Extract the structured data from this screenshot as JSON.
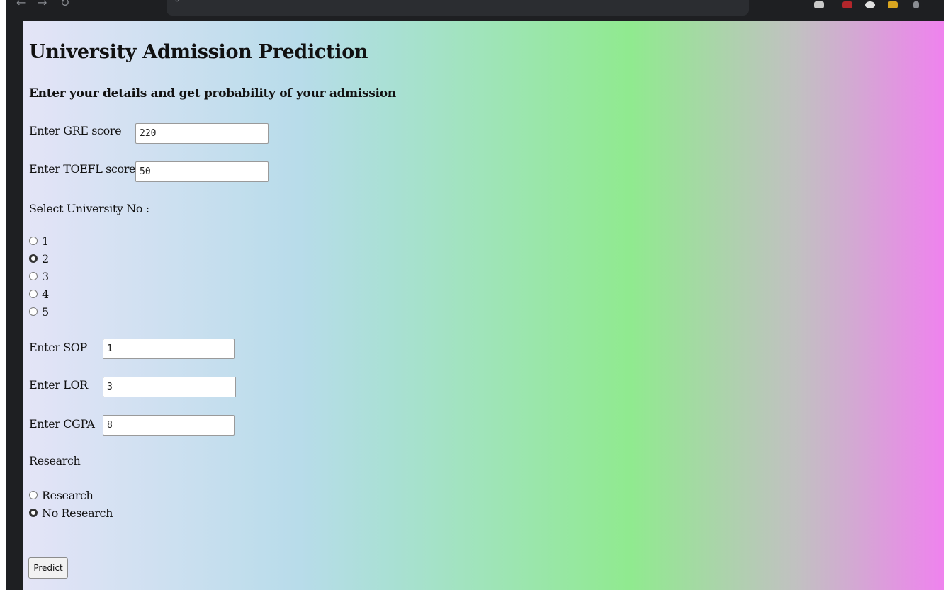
{
  "page": {
    "title": "University Admission Prediction",
    "subtitle": "Enter your details and get probability of your admission"
  },
  "form": {
    "gre": {
      "label": "Enter GRE score",
      "value": "220"
    },
    "toefl": {
      "label": "Enter TOEFL score",
      "value": "50"
    },
    "university": {
      "label": "Select University No :",
      "options": [
        "1",
        "2",
        "3",
        "4",
        "5"
      ],
      "selected": "2"
    },
    "sop": {
      "label": "Enter SOP",
      "value": "1"
    },
    "lor": {
      "label": "Enter LOR",
      "value": "3"
    },
    "cgpa": {
      "label": "Enter CGPA",
      "value": "8"
    },
    "research": {
      "label": "Research",
      "options": [
        "Research",
        "No Research"
      ],
      "selected": "No Research"
    },
    "predict_label": "Predict"
  },
  "colors": {
    "gradient": [
      "#e4e4f7",
      "#b8dcea",
      "#a9e0d4",
      "#90ea8f",
      "#c1c1c1",
      "#ef83ee"
    ],
    "browser_chrome": "#1e1f22"
  }
}
